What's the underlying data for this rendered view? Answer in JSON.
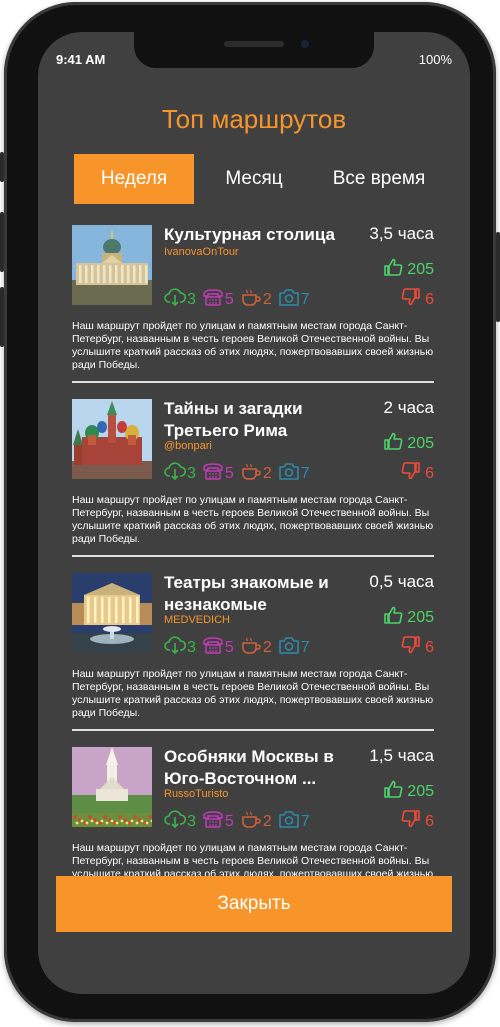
{
  "status_bar": {
    "time": "9:41 AM",
    "battery": "100%"
  },
  "title": "Топ маршрутов",
  "tabs": [
    {
      "label": "Неделя",
      "active": true
    },
    {
      "label": "Месяц",
      "active": false
    },
    {
      "label": "Все время",
      "active": false
    }
  ],
  "routes": [
    {
      "title": "Культурная столица",
      "author": "IvanovaOnTour",
      "duration": "3,5 часа",
      "likes": "205",
      "dislikes": "6",
      "stats": {
        "downloads": "3",
        "calls": "5",
        "cafes": "2",
        "photos": "7"
      },
      "description": "Наш маршрут пройдет по улицам и памятным местам города Санкт-Петербург, названным в честь героев Великой Отечественной войны. Вы услышите краткий рассказ об этих людях, пожертвовавших своей жизнью ради Победы.",
      "thumbnail": "kazan-cathedral-photo"
    },
    {
      "title": "Тайны и загадки Третьего Рима",
      "author": "@bonpari",
      "duration": "2 часа",
      "likes": "205",
      "dislikes": "6",
      "stats": {
        "downloads": "3",
        "calls": "5",
        "cafes": "2",
        "photos": "7"
      },
      "description": "Наш маршрут пройдет по улицам и памятным местам города Санкт-Петербург, названным в честь героев Великой Отечественной войны. Вы услышите краткий рассказ об этих людях, пожертвовавших своей жизнью ради Победы.",
      "thumbnail": "st-basils-cathedral-photo"
    },
    {
      "title": "Театры знакомые и незнакомые",
      "author": "MEDVEDICH",
      "duration": "0,5 часа",
      "likes": "205",
      "dislikes": "6",
      "stats": {
        "downloads": "3",
        "calls": "5",
        "cafes": "2",
        "photos": "7"
      },
      "description": "Наш маршрут пройдет по улицам и памятным местам города Санкт-Петербург, названным в честь героев Великой Отечественной войны. Вы услышите краткий рассказ об этих людях, пожертвовавших своей жизнью ради Победы.",
      "thumbnail": "bolshoi-theatre-photo"
    },
    {
      "title": "Особняки Москвы в Юго-Восточном ...",
      "author": "RussoTuristo",
      "duration": "1,5 часа",
      "likes": "205",
      "dislikes": "6",
      "stats": {
        "downloads": "3",
        "calls": "5",
        "cafes": "2",
        "photos": "7"
      },
      "description": "Наш маршрут пройдет по улицам и памятным местам города Санкт-Петербург, названным в честь героев Великой Отечественной войны. Вы услышите краткий рассказ об этих людях, пожертвовавших своей жизнью ради Победы.",
      "thumbnail": "kolomenskoye-church-photo"
    }
  ],
  "close_button": "Закрыть",
  "colors": {
    "accent": "#f7952b",
    "background": "#404040",
    "like": "#4cd36a",
    "dislike": "#f04a3a",
    "downloads": "#3cb44b",
    "calls": "#c23ab8",
    "cafes": "#d0603a",
    "photos": "#2a8aa8"
  },
  "icons": [
    "thumbs-up-icon",
    "thumbs-down-icon",
    "cloud-download-icon",
    "phone-icon",
    "coffee-cup-icon",
    "camera-icon"
  ]
}
